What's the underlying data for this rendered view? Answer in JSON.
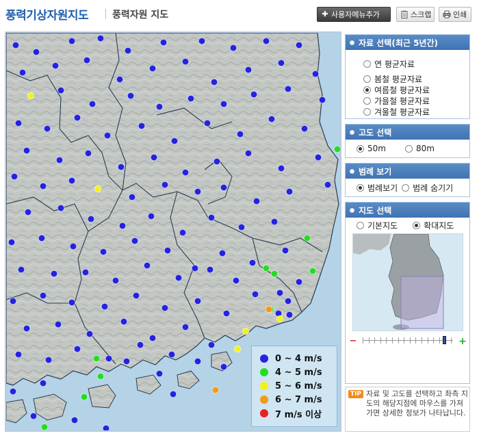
{
  "header": {
    "site_title": "풍력기상자원지도",
    "page_title": "풍력자원 지도",
    "buttons": {
      "user_menu": "사용자메뉴추가",
      "scrap": "스크랩",
      "print": "인쇄"
    }
  },
  "map": {
    "legend": [
      {
        "label": "0 ~ 4 m/s",
        "color": "#2323e0"
      },
      {
        "label": "4 ~ 5 m/s",
        "color": "#22dd22"
      },
      {
        "label": "5 ~ 6 m/s",
        "color": "#f2f21a"
      },
      {
        "label": "6 ~ 7 m/s",
        "color": "#f29a1a"
      },
      {
        "label": "7 m/s 이상",
        "color": "#e82020"
      }
    ]
  },
  "panel": {
    "data_select": {
      "title": "자료 선택(최근 5년간)",
      "options": [
        {
          "label": "연 평균자료",
          "selected": false
        },
        {
          "label": "봄철 평균자료",
          "selected": false
        },
        {
          "label": "여름철 평균자료",
          "selected": true
        },
        {
          "label": "가을철 평균자료",
          "selected": false
        },
        {
          "label": "겨울철 평균자료",
          "selected": false
        }
      ]
    },
    "altitude": {
      "title": "고도 선택",
      "options": [
        {
          "label": "50m",
          "selected": true
        },
        {
          "label": "80m",
          "selected": false
        }
      ]
    },
    "legend_view": {
      "title": "범례 보기",
      "options": [
        {
          "label": "범례보기",
          "selected": true
        },
        {
          "label": "범례 숨기기",
          "selected": false
        }
      ]
    },
    "map_select": {
      "title": "지도 선택",
      "options": [
        {
          "label": "기본지도",
          "selected": false
        },
        {
          "label": "확대지도",
          "selected": true
        }
      ],
      "zoom_level": 0.9
    },
    "tip": {
      "badge": "TIP",
      "text": "자료 및 고도를 선택하고 좌측 지도의 해당지점에 마우스를 가져가면 상세한 정보가 나타납니다."
    }
  }
}
